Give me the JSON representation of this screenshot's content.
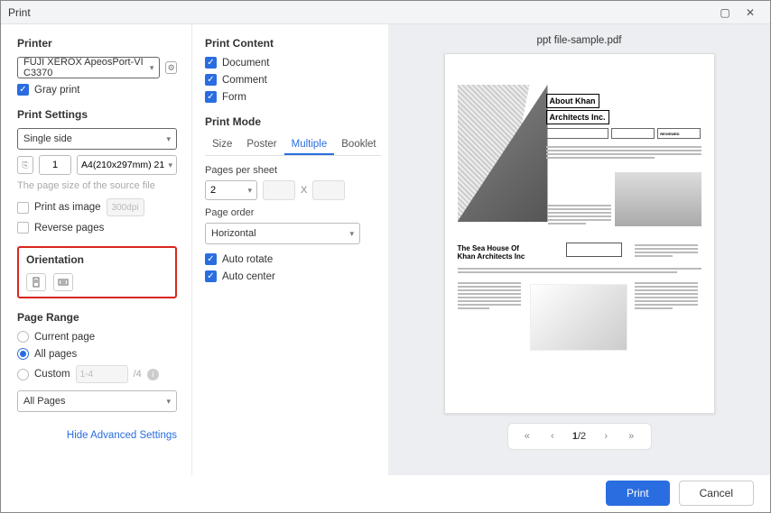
{
  "window": {
    "title": "Print"
  },
  "printer": {
    "heading": "Printer",
    "selected": "FUJI XEROX ApeosPort-VI C3370",
    "gray_print": "Gray print"
  },
  "settings": {
    "heading": "Print Settings",
    "sides": "Single side",
    "copies": "1",
    "paper": "A4(210x297mm) 21",
    "source_size": "The page size of the source file",
    "print_as_image": "Print as image",
    "dpi": "300dpi",
    "reverse": "Reverse pages"
  },
  "orientation": {
    "heading": "Orientation"
  },
  "range": {
    "heading": "Page Range",
    "current": "Current page",
    "all": "All pages",
    "custom": "Custom",
    "custom_ph": "1-4",
    "total": "/4",
    "filter": "All Pages"
  },
  "advanced_link": "Hide Advanced Settings",
  "content": {
    "heading": "Print Content",
    "document": "Document",
    "comment": "Comment",
    "form": "Form"
  },
  "mode": {
    "heading": "Print Mode",
    "tabs": {
      "size": "Size",
      "poster": "Poster",
      "multiple": "Multiple",
      "booklet": "Booklet"
    },
    "pps_label": "Pages per sheet",
    "pps_value": "2",
    "x": "X",
    "order_label": "Page order",
    "order_value": "Horizontal",
    "auto_rotate": "Auto rotate",
    "auto_center": "Auto center"
  },
  "preview": {
    "filename": "ppt file-sample.pdf",
    "slide1": {
      "title_l1": "About Khan",
      "title_l2": "Architects Inc.",
      "label_reviewed": "REVIEWED"
    },
    "slide2": {
      "title_l1": "The Sea House Of",
      "title_l2": "Khan Architects Inc"
    },
    "pager": {
      "current": "1",
      "total": "/2"
    }
  },
  "footer": {
    "print": "Print",
    "cancel": "Cancel"
  }
}
